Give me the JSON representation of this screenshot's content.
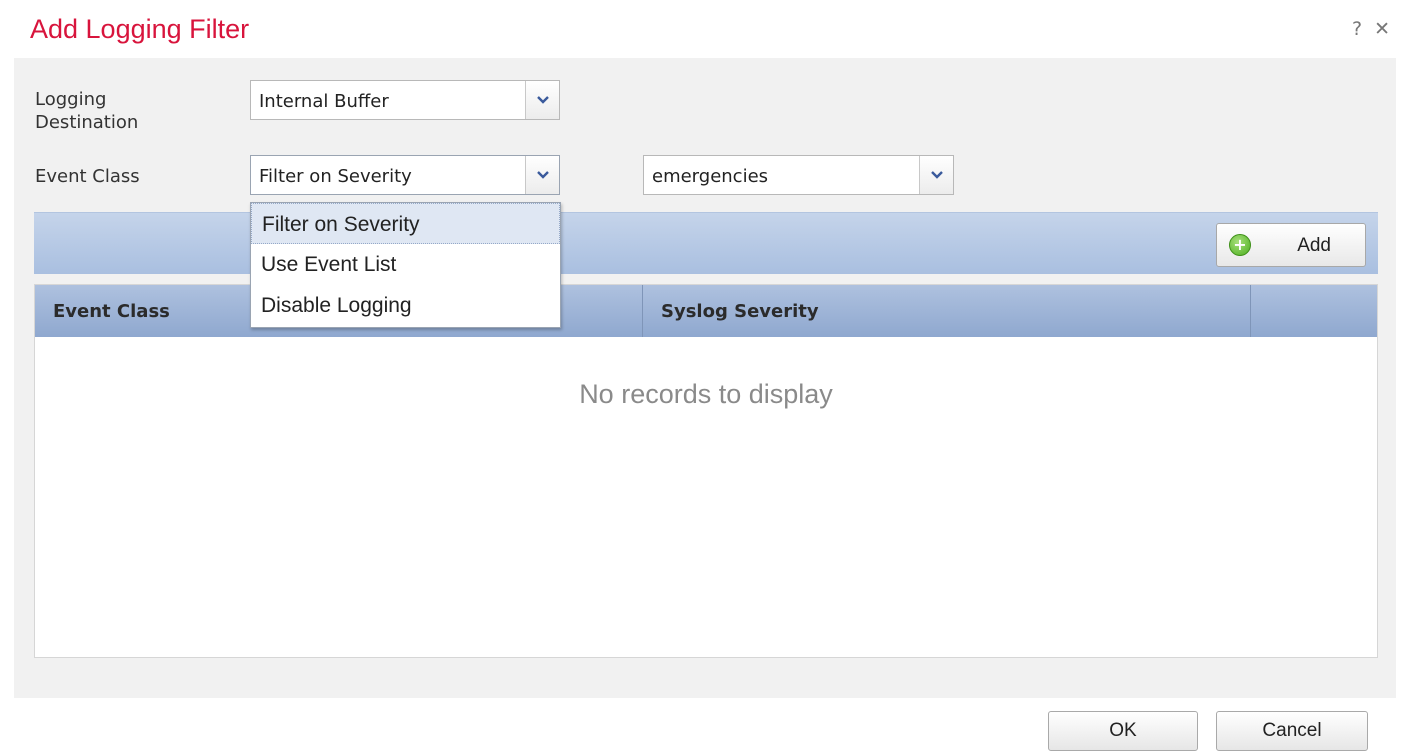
{
  "dialog": {
    "title": "Add Logging Filter",
    "help_label": "?",
    "close_label": "✕"
  },
  "form": {
    "logging_destination": {
      "label": "Logging\nDestination",
      "value": "Internal Buffer"
    },
    "event_class": {
      "label": "Event Class",
      "value": "Filter on Severity",
      "options": [
        "Filter on Severity",
        "Use Event List",
        "Disable Logging"
      ],
      "selected_option": "Filter on Severity"
    },
    "severity": {
      "value": "emergencies"
    }
  },
  "toolbar": {
    "add_label": "Add"
  },
  "grid": {
    "columns": [
      "Event Class",
      "Syslog Severity"
    ],
    "empty_message": "No records to display"
  },
  "footer": {
    "ok_label": "OK",
    "cancel_label": "Cancel"
  },
  "colors": {
    "title": "#d8143c",
    "header_blue": "#a9bfe0",
    "add_icon_green": "#4cae1e",
    "chevron": "#3a5a9c"
  }
}
